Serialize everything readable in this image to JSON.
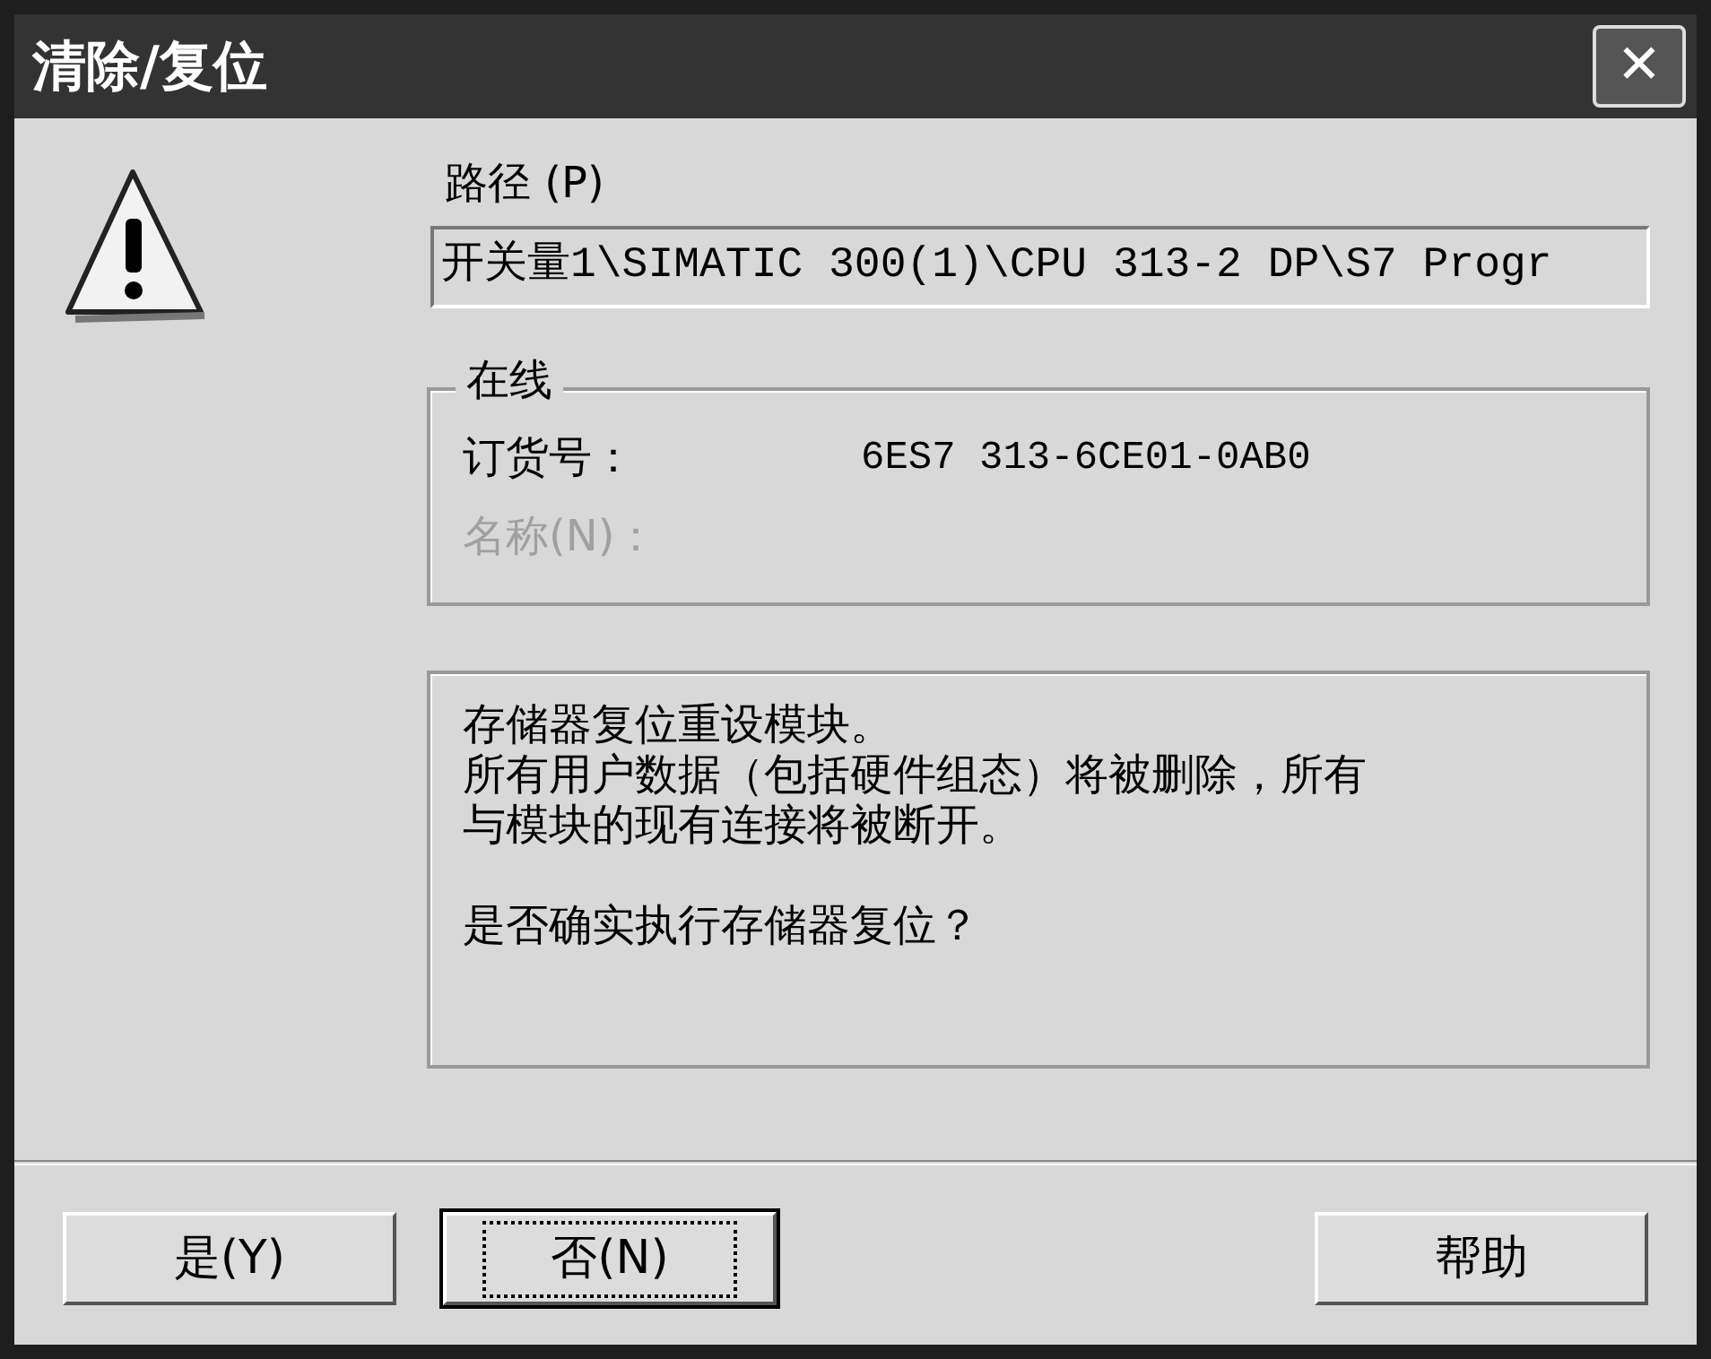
{
  "window": {
    "title": "清除/复位",
    "close": "✕"
  },
  "path": {
    "label": "路径 (P)",
    "value": "开关量1\\SIMATIC 300(1)\\CPU 313-2 DP\\S7 Progr"
  },
  "online": {
    "legend": "在线",
    "rows": [
      {
        "label": "订货号：",
        "value": "6ES7 313-6CE01-0AB0",
        "disabled": false
      },
      {
        "label": "名称(N)：",
        "value": "",
        "disabled": true
      }
    ]
  },
  "message": {
    "lines": [
      "存储器复位重设模块。",
      "所有用户数据（包括硬件组态）将被删除，所有",
      "与模块的现有连接将被断开。"
    ],
    "question": "是否确实执行存储器复位？"
  },
  "buttons": [
    {
      "label": "是(Y)",
      "focused": false
    },
    {
      "label": "否(N)",
      "focused": true
    },
    {
      "label": "帮助",
      "focused": false
    }
  ]
}
